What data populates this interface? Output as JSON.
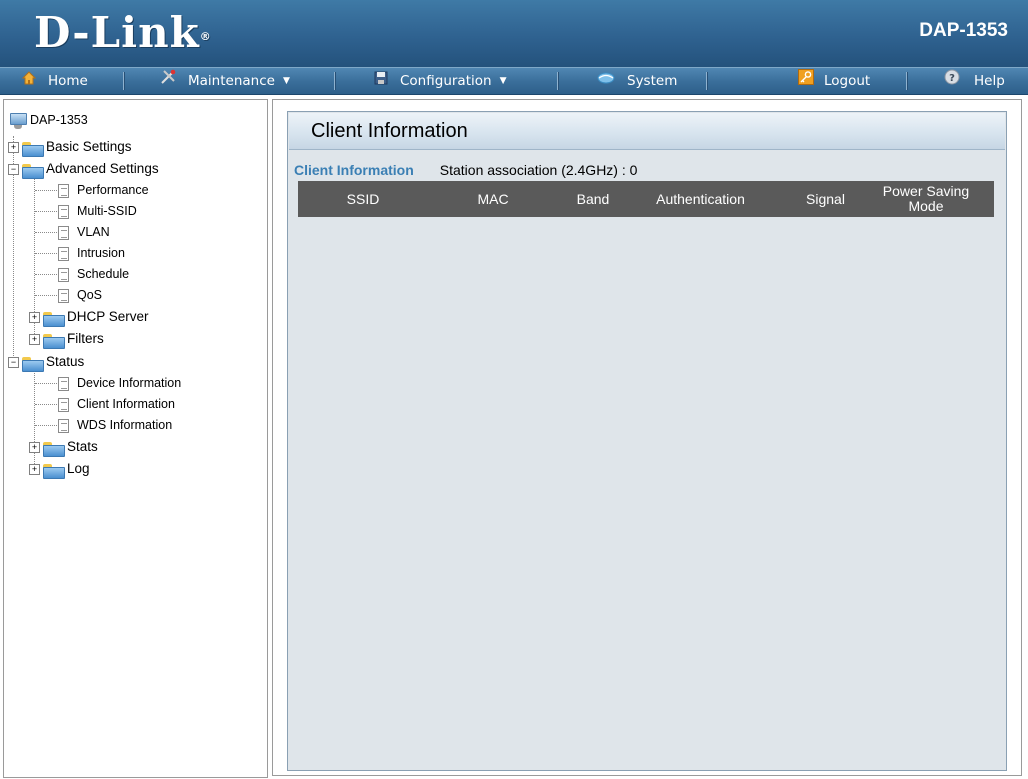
{
  "header": {
    "logo": "D-Link",
    "registered_mark": "®",
    "model": "DAP-1353"
  },
  "menu": {
    "items": [
      {
        "label": "Home",
        "icon": "home-icon"
      },
      {
        "label": "Maintenance",
        "icon": "tools-icon",
        "dropdown": true
      },
      {
        "label": "Configuration",
        "icon": "save-disk-icon",
        "dropdown": true
      },
      {
        "label": "System",
        "icon": "system-icon"
      },
      {
        "label": "Logout",
        "icon": "key-icon"
      },
      {
        "label": "Help",
        "icon": "help-icon"
      }
    ]
  },
  "sidebar": {
    "root": "DAP-1353",
    "basic_settings": "Basic Settings",
    "advanced_settings": "Advanced Settings",
    "advanced_items": [
      "Performance",
      "Multi-SSID",
      "VLAN",
      "Intrusion",
      "Schedule",
      "QoS"
    ],
    "dhcp_server": "DHCP Server",
    "filters": "Filters",
    "status": "Status",
    "status_items": [
      "Device Information",
      "Client Information",
      "WDS Information"
    ],
    "stats": "Stats",
    "log": "Log"
  },
  "main": {
    "title": "Client Information",
    "section_title": "Client Information",
    "station_association": "Station association (2.4GHz) : 0",
    "table": {
      "columns": [
        "SSID",
        "MAC",
        "Band",
        "Authentication",
        "Signal",
        "Power Saving Mode"
      ],
      "rows": []
    }
  }
}
